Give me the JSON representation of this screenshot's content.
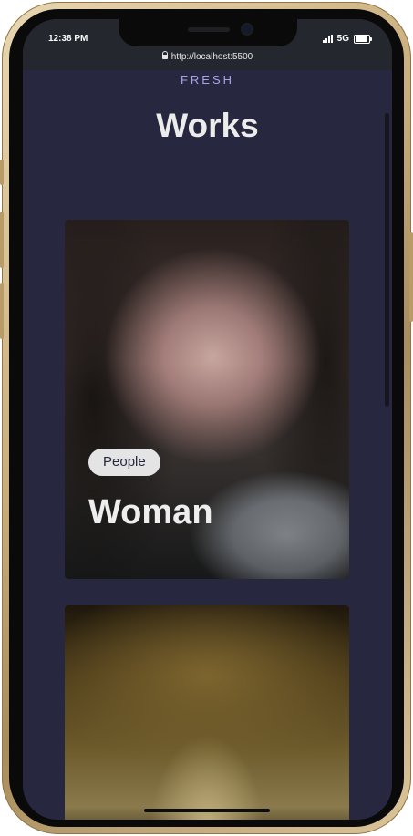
{
  "status_bar": {
    "time": "12:38 PM",
    "network": "5G",
    "icons": [
      "signal-icon",
      "battery-icon"
    ]
  },
  "browser": {
    "url": "http://localhost:5500",
    "icons": [
      "lock-icon"
    ]
  },
  "site": {
    "brand": "FRESH",
    "page_title": "Works"
  },
  "cards": [
    {
      "tag": "People",
      "title": "Woman"
    },
    {
      "tag": "",
      "title": ""
    }
  ],
  "colors": {
    "page_background": "#272840",
    "brand_accent": "#a9a4e8",
    "title_text": "#ececec",
    "tag_background": "#e4e4e4",
    "frame_gold": "#c9ae7c"
  }
}
